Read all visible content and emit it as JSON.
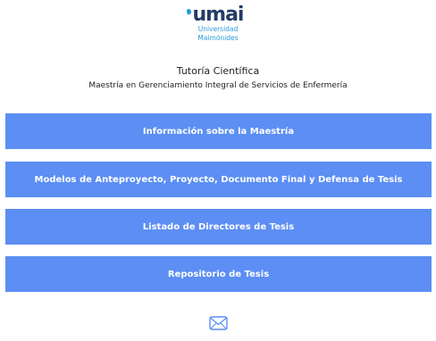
{
  "logo": {
    "wordmark": "umai",
    "line1": "Universidad",
    "line2": "Maimónides"
  },
  "header": {
    "title": "Tutoría Científica",
    "subtitle": "Maestría en Gerenciamiento Integral de Servicios de Enfermería"
  },
  "buttons": [
    {
      "label": "Información sobre la Maestría"
    },
    {
      "label": "Modelos de Anteproyecto, Proyecto, Documento Final y Defensa de Tesis"
    },
    {
      "label": "Listado de Directores de Tesis"
    },
    {
      "label": "Repositorio de Tesis"
    }
  ],
  "footer": {
    "icon": "mail-icon"
  },
  "colors": {
    "button_bg": "#5c8ef3",
    "logo_dark": "#243b66",
    "logo_accent": "#2a9ad8"
  }
}
